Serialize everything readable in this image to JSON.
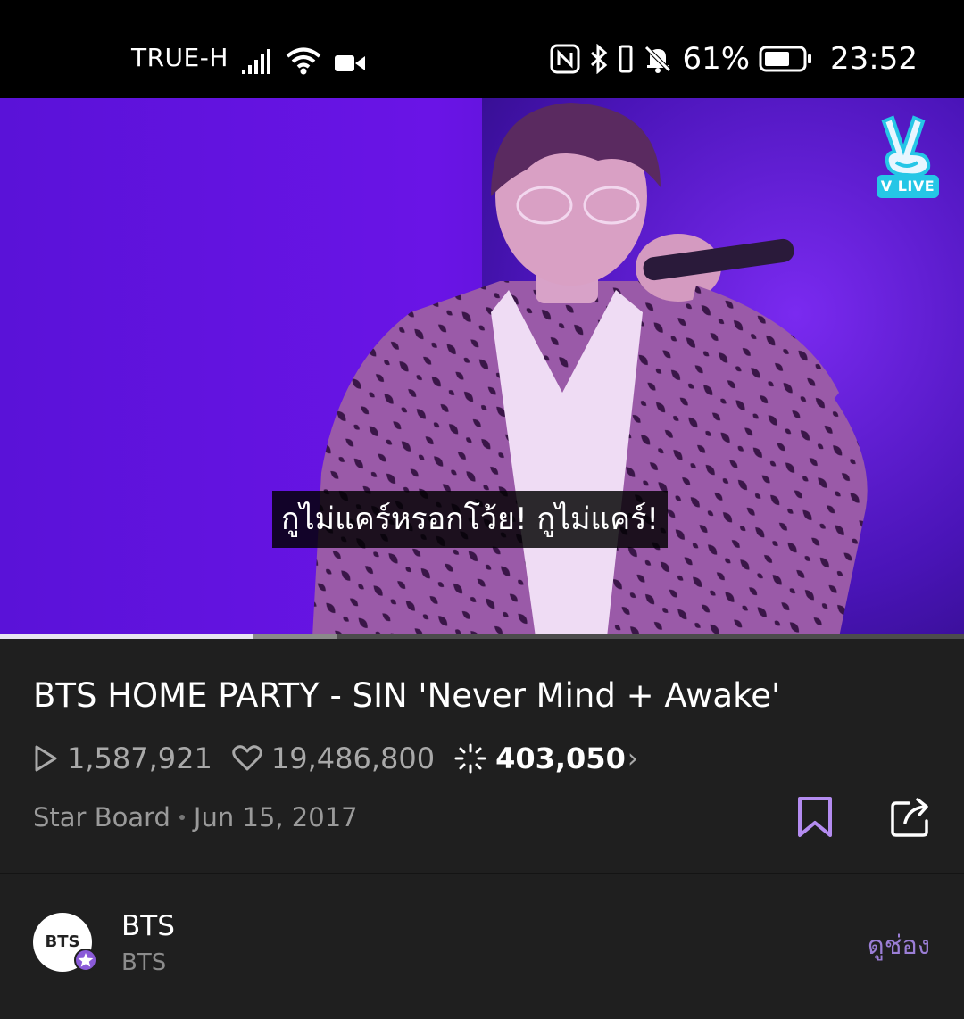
{
  "status_bar": {
    "carrier": "TRUE-H",
    "battery_percent": "61%",
    "time": "23:52"
  },
  "video": {
    "subtitle": "กูไม่แคร์หรอกโว้ย! กูไม่แคร์!",
    "watermark": "V LIVE",
    "progress_fraction": 0.263,
    "buffered_fraction": 0.349
  },
  "info": {
    "title": "BTS HOME PARTY - SIN 'Never Mind + Awake'",
    "plays": "1,587,921",
    "likes": "19,486,800",
    "stars": "403,050",
    "board": "Star Board",
    "date": "Jun 15, 2017"
  },
  "channel": {
    "avatar_text": "BTS",
    "name": "BTS",
    "subtitle": "BTS",
    "view_channel": "ดูช่อง"
  },
  "colors": {
    "accent_purple": "#9b7ed6",
    "bookmark": "#b48cf0",
    "background": "#1f1f1f"
  }
}
